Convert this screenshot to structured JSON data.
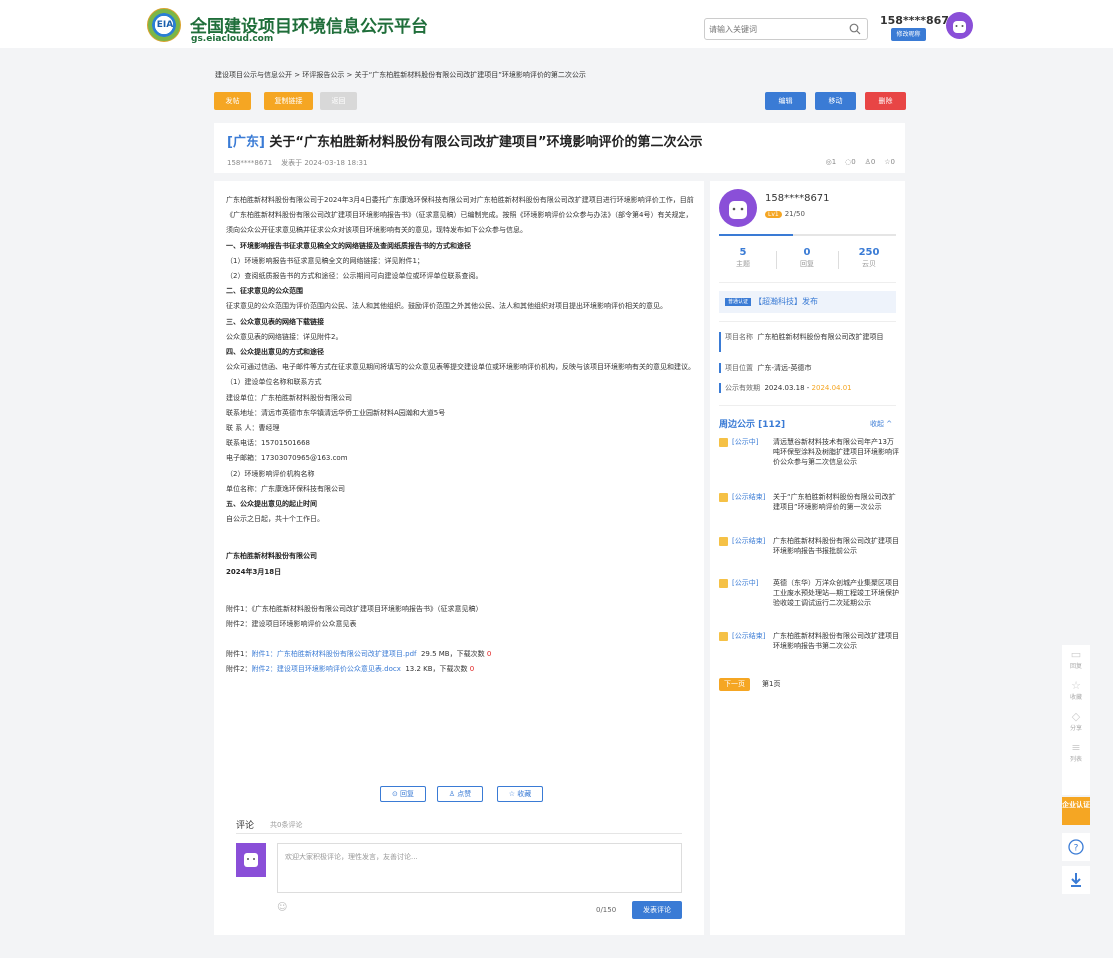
{
  "header": {
    "logo_text": "EIA",
    "site_title": "全国建设项目环境信息公示平台",
    "site_url": "gs.eiacloud.com",
    "search_placeholder": "请输入关键词",
    "user_phone": "158****8671",
    "edit_name_label": "修改昵称"
  },
  "breadcrumb": "建设项目公示与信息公开 > 环评报告公示 > 关于“广东柏胜新材料股份有限公司改扩建项目”环境影响评价的第二次公示",
  "toolbar": {
    "post": "发帖",
    "copy_link": "复制链接",
    "back": "返回",
    "edit": "编辑",
    "move": "移动",
    "delete": "删除"
  },
  "post": {
    "region": "[广东]",
    "title": "关于“广东柏胜新材料股份有限公司改扩建项目”环境影响评价的第二次公示",
    "author": "158****8671",
    "published": "发表于 2024-03-18 18:31",
    "views": "1",
    "comments": "0",
    "likes": "0",
    "favorites": "0"
  },
  "body": {
    "intro": "广东柏胜新材料股份有限公司于2024年3月4日委托广东康逸环保科技有限公司对广东柏胜新材料股份有限公司改扩建项目进行环境影响评价工作，目前《广东柏胜新材料股份有限公司改扩建项目环境影响报告书》（征求意见稿）已编制完成。按照《环境影响评价公众参与办法》（部令第4号）有关规定，须向公众公开征求意见稿并征求公众对该项目环境影响有关的意见，现特发布如下公众参与信息。",
    "s1": "一、环境影响报告书征求意见稿全文的网络链接及查阅纸质报告书的方式和途径",
    "s1_1": "（1）环境影响报告书征求意见稿全文的网络链接：详见附件1；",
    "s1_2": "（2）查阅纸质报告书的方式和途径：公示期间可向建设单位或环评单位联系查阅。",
    "s2": "二、征求意见的公众范围",
    "s2_text": "征求意见的公众范围为评价范围内公民、法人和其他组织。鼓励评价范围之外其他公民、法人和其他组织对项目提出环境影响评价相关的意见。",
    "s3": "三、公众意见表的网络下载链接",
    "s3_text": "公众意见表的网络链接：详见附件2。",
    "s4": "四、公众提出意见的方式和途径",
    "s4_text": "公众可通过信函、电子邮件等方式在征求意见期间将填写的公众意见表等提交建设单位或环境影响评价机构，反映与该项目环境影响有关的意见和建议。",
    "s4_1": "（1）建设单位名称和联系方式",
    "s4_unit": "建设单位：广东柏胜新材料股份有限公司",
    "s4_addr": "联系地址：清远市英德市东华镇清远华侨工业园新材料A园瀚和大道5号",
    "s4_contact": "联 系 人：曹经理",
    "s4_phone": "联系电话：15701501668",
    "s4_email": "电子邮箱：17303070965@163.com",
    "s4_2": "（2）环境影响评价机构名称",
    "s4_org": "单位名称：广东康逸环保科技有限公司",
    "s5": "五、公众提出意见的起止时间",
    "s5_text": "自公示之日起，共十个工作日。",
    "signer": "广东柏胜新材料股份有限公司",
    "date": "2024年3月18日",
    "att_note1": "附件1：《广东柏胜新材料股份有限公司改扩建项目环境影响报告书》（征求意见稿）",
    "att_note2": "附件2：建设项目环境影响评价公众意见表",
    "att1_prefix": "附件1：",
    "att1_link": "附件1：广东柏胜新材料股份有限公司改扩建项目.pdf",
    "att1_info": "29.5 MB，下载次数",
    "att1_count": "0",
    "att2_prefix": "附件2：",
    "att2_link": "附件2：建设项目环境影响评价公众意见表.docx",
    "att2_info": "13.2 KB，下载次数",
    "att2_count": "0"
  },
  "actions": {
    "reply": "回复",
    "like": "点赞",
    "favorite": "收藏"
  },
  "comment": {
    "heading": "评论",
    "count": "共0条评论",
    "placeholder": "欢迎大家积极评论，理性发言，友善讨论...",
    "counter": "0/150",
    "submit": "发表评论"
  },
  "sidebar": {
    "user": "158****8671",
    "level_badge": "Lv1",
    "level_progress": "21/50",
    "level_fraction": 0.42,
    "stats": [
      {
        "num": "5",
        "label": "主题"
      },
      {
        "num": "0",
        "label": "回复"
      },
      {
        "num": "250",
        "label": "云贝"
      }
    ],
    "publisher_badge": "普通认证",
    "publisher": "【超瀚科技】发布",
    "project_name_label": "项目名称",
    "project_name": "广东柏胜新材料股份有限公司改扩建项目",
    "project_loc_label": "项目位置",
    "project_loc": "广东-清远-英德市",
    "valid_label": "公示有效期",
    "valid_start": "2024.03.18",
    "valid_sep": " - ",
    "valid_end": "2024.04.01",
    "nearby_title": "周边公示 [112]",
    "collapse": "收起 ^",
    "nearby": [
      {
        "status": "[公示中]",
        "text": "清远慧谷新材料技术有限公司年产13万吨环保型涂料及树脂扩建项目环境影响评价公众参与第二次信息公示"
      },
      {
        "status": "[公示结束]",
        "text": "关于“广东柏胜新材料股份有限公司改扩建项目”环境影响评价的第一次公示"
      },
      {
        "status": "[公示结束]",
        "text": "广东柏胜新材料股份有限公司改扩建项目环境影响报告书报批前公示"
      },
      {
        "status": "[公示中]",
        "text": "英德（东华）万洋众创城产业集聚区项目工业废水预处理站—期工程竣工环境保护验收竣工调试运行二次延期公示"
      },
      {
        "status": "[公示结束]",
        "text": "广东柏胜新材料股份有限公司改扩建项目环境影响报告书第二次公示"
      }
    ],
    "next_page": "下一页",
    "page": "第1页"
  },
  "floating": {
    "reply": "回复",
    "favorite": "收藏",
    "share": "分享",
    "list": "列表",
    "enterprise": "企业认证"
  },
  "colors": {
    "accent": "#3a7bd5",
    "orange": "#f5a623",
    "danger": "#e84545",
    "brand_green": "#1f6e3a"
  }
}
